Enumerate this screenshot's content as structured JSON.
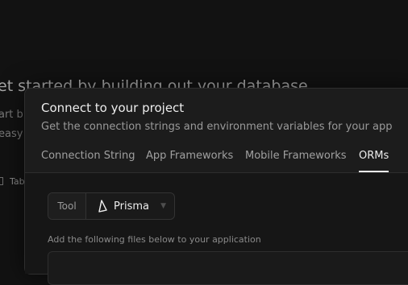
{
  "background": {
    "heading": "et started by building out your database",
    "lines": [
      "art b",
      "easy"
    ],
    "tab_label": "Tab"
  },
  "modal": {
    "title": "Connect to your project",
    "description": "Get the connection strings and environment variables for your app",
    "tabs": [
      {
        "label": "Connection String",
        "active": false
      },
      {
        "label": "App Frameworks",
        "active": false
      },
      {
        "label": "Mobile Frameworks",
        "active": false
      },
      {
        "label": "ORMs",
        "active": true
      }
    ],
    "tool": {
      "label": "Tool",
      "value": "Prisma",
      "icon": "prisma-icon"
    },
    "hint": "Add the following files below to your application"
  },
  "colors": {
    "page_bg": "#121212",
    "modal_bg": "#1c1c1c",
    "text_primary": "#ededed",
    "text_muted": "#9a9a9a"
  }
}
